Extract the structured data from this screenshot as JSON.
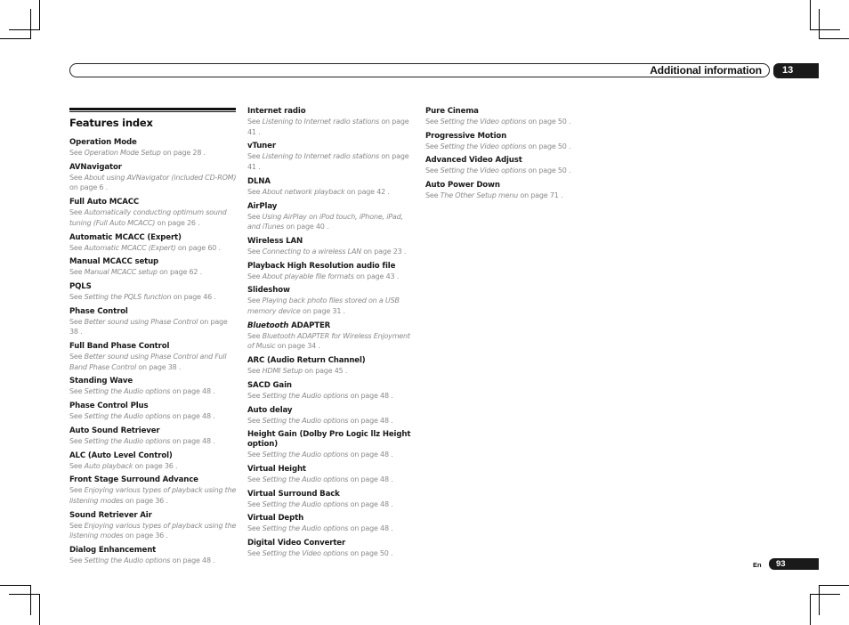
{
  "header": {
    "title": "Additional information",
    "chapter_number": "13"
  },
  "section": {
    "title": "Features index"
  },
  "columns": [
    [
      {
        "term": "Operation Mode",
        "see": "See ",
        "link": "Operation Mode Setup",
        "tail": " on page 28 ."
      },
      {
        "term": "AVNavigator",
        "see": "See ",
        "link": "About using AVNavigator (included CD-ROM)",
        "tail": " on page 6 ."
      },
      {
        "term": "Full Auto MCACC",
        "see": "See ",
        "link": "Automatically conducting optimum sound tuning (Full Auto MCACC)",
        "tail": " on page 26 ."
      },
      {
        "term": "Automatic MCACC (Expert)",
        "see": "See ",
        "link": "Automatic MCACC (Expert)",
        "tail": " on page 60 ."
      },
      {
        "term": "Manual MCACC setup",
        "see": "See ",
        "link": "Manual MCACC setup",
        "tail": " on page 62 ."
      },
      {
        "term": "PQLS",
        "see": "See ",
        "link": "Setting the PQLS function",
        "tail": " on page 46 ."
      },
      {
        "term": "Phase Control",
        "see": "See ",
        "link": "Better sound using Phase Control",
        "tail": " on page 38 ."
      },
      {
        "term": "Full Band Phase Control",
        "see": "See ",
        "link": "Better sound using Phase Control and Full Band Phase Control",
        "tail": " on page 38 ."
      },
      {
        "term": "Standing Wave",
        "see": "See ",
        "link": "Setting the Audio options",
        "tail": " on page 48 ."
      },
      {
        "term": "Phase Control Plus",
        "see": "See ",
        "link": "Setting the Audio options",
        "tail": " on page 48 ."
      },
      {
        "term": "Auto Sound Retriever",
        "see": "See ",
        "link": "Setting the Audio options",
        "tail": " on page 48 ."
      },
      {
        "term": "ALC (Auto Level Control)",
        "see": "See ",
        "link": "Auto playback",
        "tail": " on page 36 ."
      },
      {
        "term": "Front Stage Surround Advance",
        "see": "See ",
        "link": "Enjoying various types of playback using the listening modes",
        "tail": " on page 36 ."
      },
      {
        "term": "Sound Retriever Air",
        "see": "See ",
        "link": "Enjoying various types of playback using the listening modes",
        "tail": " on page 36 ."
      },
      {
        "term": "Dialog Enhancement",
        "see": "See ",
        "link": "Setting the Audio options",
        "tail": " on page 48 ."
      }
    ],
    [
      {
        "term": "Internet radio",
        "see": "See ",
        "link": "Listening to Internet radio stations",
        "tail": " on page 41 ."
      },
      {
        "term": "vTuner",
        "see": "See ",
        "link": "Listening to Internet radio stations",
        "tail": " on page 41 ."
      },
      {
        "term": "DLNA",
        "see": "See ",
        "link": "About network playback",
        "tail": " on page 42 ."
      },
      {
        "term": "AirPlay",
        "see": "See ",
        "link": "Using AirPlay on iPod touch, iPhone, iPad, and iTunes",
        "tail": " on page 40 ."
      },
      {
        "term": "Wireless LAN",
        "see": "See ",
        "link": "Connecting to a wireless LAN",
        "tail": " on page 23 ."
      },
      {
        "term": "Playback High Resolution audio file",
        "see": "See ",
        "link": "About playable file formats",
        "tail": " on page 43 ."
      },
      {
        "term": "Slideshow",
        "see": "See ",
        "link": "Playing back photo files stored on a USB memory device",
        "tail": " on page 31 ."
      },
      {
        "term_italic": "Bluetooth",
        "term": " ADAPTER",
        "see": "See ",
        "link": "Bluetooth ADAPTER for Wireless Enjoyment of Music",
        "tail": " on page 34 ."
      },
      {
        "term": "ARC (Audio Return Channel)",
        "see": "See ",
        "link": "HDMI Setup",
        "tail": " on page 45 ."
      },
      {
        "term": "SACD Gain",
        "see": "See ",
        "link": "Setting the Audio options",
        "tail": " on page 48 ."
      },
      {
        "term": "Auto delay",
        "see": "See ",
        "link": "Setting the Audio options",
        "tail": " on page 48 ."
      },
      {
        "term": "Height Gain (Dolby Pro Logic llz Height option)",
        "see": "See ",
        "link": "Setting the Audio options",
        "tail": " on page 48 ."
      },
      {
        "term": "Virtual Height",
        "see": "See ",
        "link": "Setting the Audio options",
        "tail": " on page 48 ."
      },
      {
        "term": "Virtual Surround Back",
        "see": "See ",
        "link": "Setting the Audio options",
        "tail": " on page 48 ."
      },
      {
        "term": "Virtual Depth",
        "see": "See ",
        "link": "Setting the Audio options",
        "tail": " on page 48 ."
      },
      {
        "term": "Digital Video Converter",
        "see": "See ",
        "link": "Setting the Video options",
        "tail": " on page 50 ."
      }
    ],
    [
      {
        "term": "Pure Cinema",
        "see": "See ",
        "link": "Setting the Video options",
        "tail": " on page 50 ."
      },
      {
        "term": "Progressive Motion",
        "see": "See ",
        "link": "Setting the Video options",
        "tail": " on page 50 ."
      },
      {
        "term": "Advanced Video Adjust",
        "see": "See ",
        "link": "Setting the Video options",
        "tail": " on page 50 ."
      },
      {
        "term": "Auto Power Down",
        "see": "See ",
        "link": "The Other Setup menu",
        "tail": " on page 71 ."
      }
    ]
  ],
  "footer": {
    "language": "En",
    "page_number": "93"
  }
}
